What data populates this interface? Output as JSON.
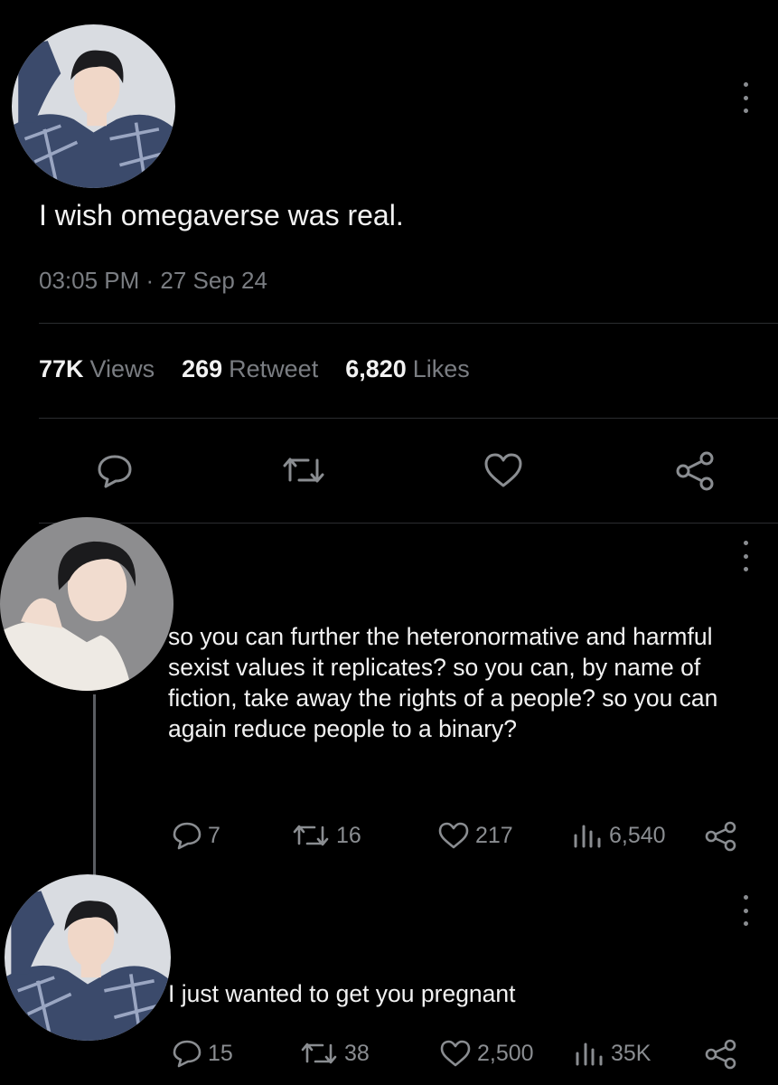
{
  "main_tweet": {
    "text": "I wish omegaverse was real.",
    "timestamp": "03:05 PM · 27 Sep 24",
    "stats": {
      "views_count": "77K",
      "views_label": "Views",
      "retweets_count": "269",
      "retweets_label": "Retweet",
      "likes_count": "6,820",
      "likes_label": "Likes"
    }
  },
  "reply_1": {
    "text": "so you can further the heteronormative and harmful sexist values it replicates? so you can, by name of fiction, take away the rights of a people? so you can again reduce people to a binary?",
    "replies": "7",
    "retweets": "16",
    "likes": "217",
    "views": "6,540"
  },
  "reply_2": {
    "text": "I just wanted to get you pregnant",
    "replies": "15",
    "retweets": "38",
    "likes": "2,500",
    "views": "35K"
  },
  "colors": {
    "background": "#000000",
    "text": "#f2f2f2",
    "muted": "#7a7d82",
    "divider": "#2b2d30"
  }
}
